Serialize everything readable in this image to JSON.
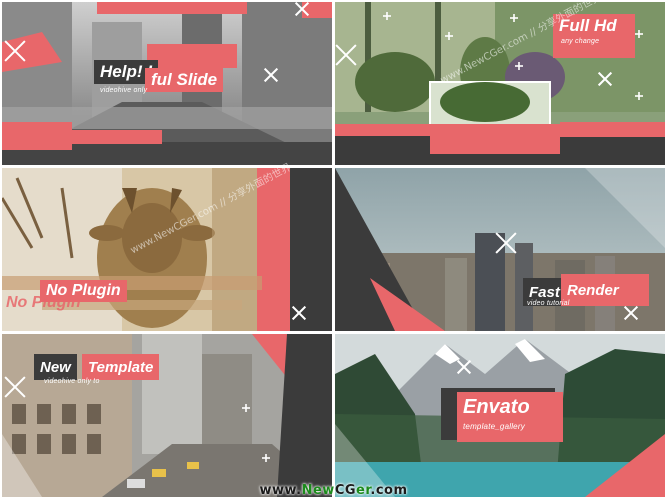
{
  "panels": [
    {
      "id": "p1",
      "title_part1": "Help! I",
      "title_part2": "ful Slide",
      "subtitle": "videohive only"
    },
    {
      "id": "p2",
      "title": "Full Hd",
      "subtitle": "any change"
    },
    {
      "id": "p3",
      "title": "No Plugin",
      "ghost_title": "No Plugin"
    },
    {
      "id": "p4",
      "title_part1": "Fast",
      "title_part2": "Render",
      "subtitle": "video tutorial"
    },
    {
      "id": "p5",
      "title_part1": "New",
      "title_part2": "Template",
      "subtitle": "videohive only to"
    },
    {
      "id": "p6",
      "title": "Envato",
      "subtitle": "template_gallery"
    }
  ],
  "watermark_text": "www.NewCGer.com // 分享外面的世界",
  "footer": {
    "prefix": "www.",
    "brand_a": "New",
    "brand_b": "CG",
    "brand_c": "er",
    "suffix": ".com"
  },
  "colors": {
    "coral": "#e8676a",
    "dark": "#3b3b3b",
    "white": "#ffffff"
  }
}
